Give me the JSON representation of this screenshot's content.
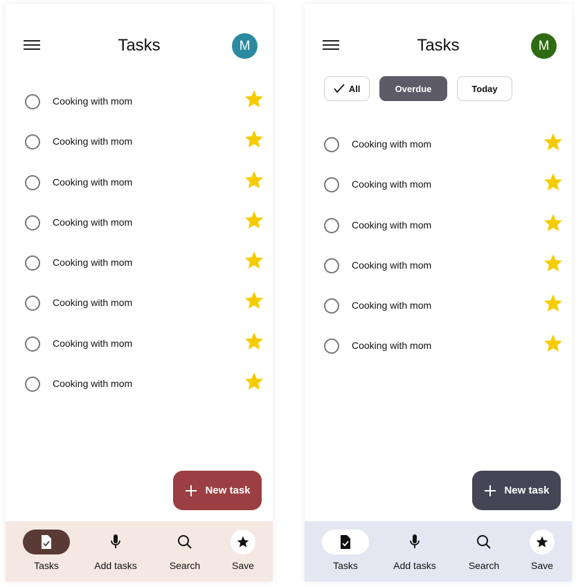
{
  "screens": [
    {
      "id": "left",
      "title": "Tasks",
      "avatar_initial": "M",
      "avatar_color": "#2b8aa0",
      "tasks": [
        {
          "label": "Cooking with mom",
          "starred": true
        },
        {
          "label": "Cooking with mom",
          "starred": true
        },
        {
          "label": "Cooking with mom",
          "starred": true
        },
        {
          "label": "Cooking with mom",
          "starred": true
        },
        {
          "label": "Cooking with mom",
          "starred": true
        },
        {
          "label": "Cooking with mom",
          "starred": true
        },
        {
          "label": "Cooking with mom",
          "starred": true
        },
        {
          "label": "Cooking with mom",
          "starred": true
        }
      ],
      "fab_label": "New task",
      "fab_color": "#9b3f42",
      "nav": {
        "tasks": "Tasks",
        "add_tasks": "Add tasks",
        "search": "Search",
        "save": "Save",
        "background": "#f5e8e3",
        "active_pill": "#5a3a35"
      }
    },
    {
      "id": "right",
      "title": "Tasks",
      "avatar_initial": "M",
      "avatar_color": "#2f6b12",
      "filters": {
        "all": "All",
        "overdue": "Overdue",
        "today": "Today",
        "selected": "Overdue"
      },
      "tasks": [
        {
          "label": "Cooking with mom",
          "starred": true
        },
        {
          "label": "Cooking with mom",
          "starred": true
        },
        {
          "label": "Cooking with mom",
          "starred": true
        },
        {
          "label": "Cooking with mom",
          "starred": true
        },
        {
          "label": "Cooking with mom",
          "starred": true
        },
        {
          "label": "Cooking with mom",
          "starred": true
        }
      ],
      "fab_label": "New task",
      "fab_color": "#454555",
      "nav": {
        "tasks": "Tasks",
        "add_tasks": "Add tasks",
        "search": "Search",
        "save": "Save",
        "background": "#e4e7f2",
        "active_pill": "#ffffff"
      }
    }
  ],
  "star_color": "#f5cc00",
  "icons": {
    "menu": "hamburger-icon",
    "star": "star-icon",
    "check": "checkmark-icon",
    "plus": "plus-icon",
    "tasks": "task-document-icon",
    "add_tasks": "microphone-icon",
    "search": "search-icon",
    "save": "star-icon"
  }
}
